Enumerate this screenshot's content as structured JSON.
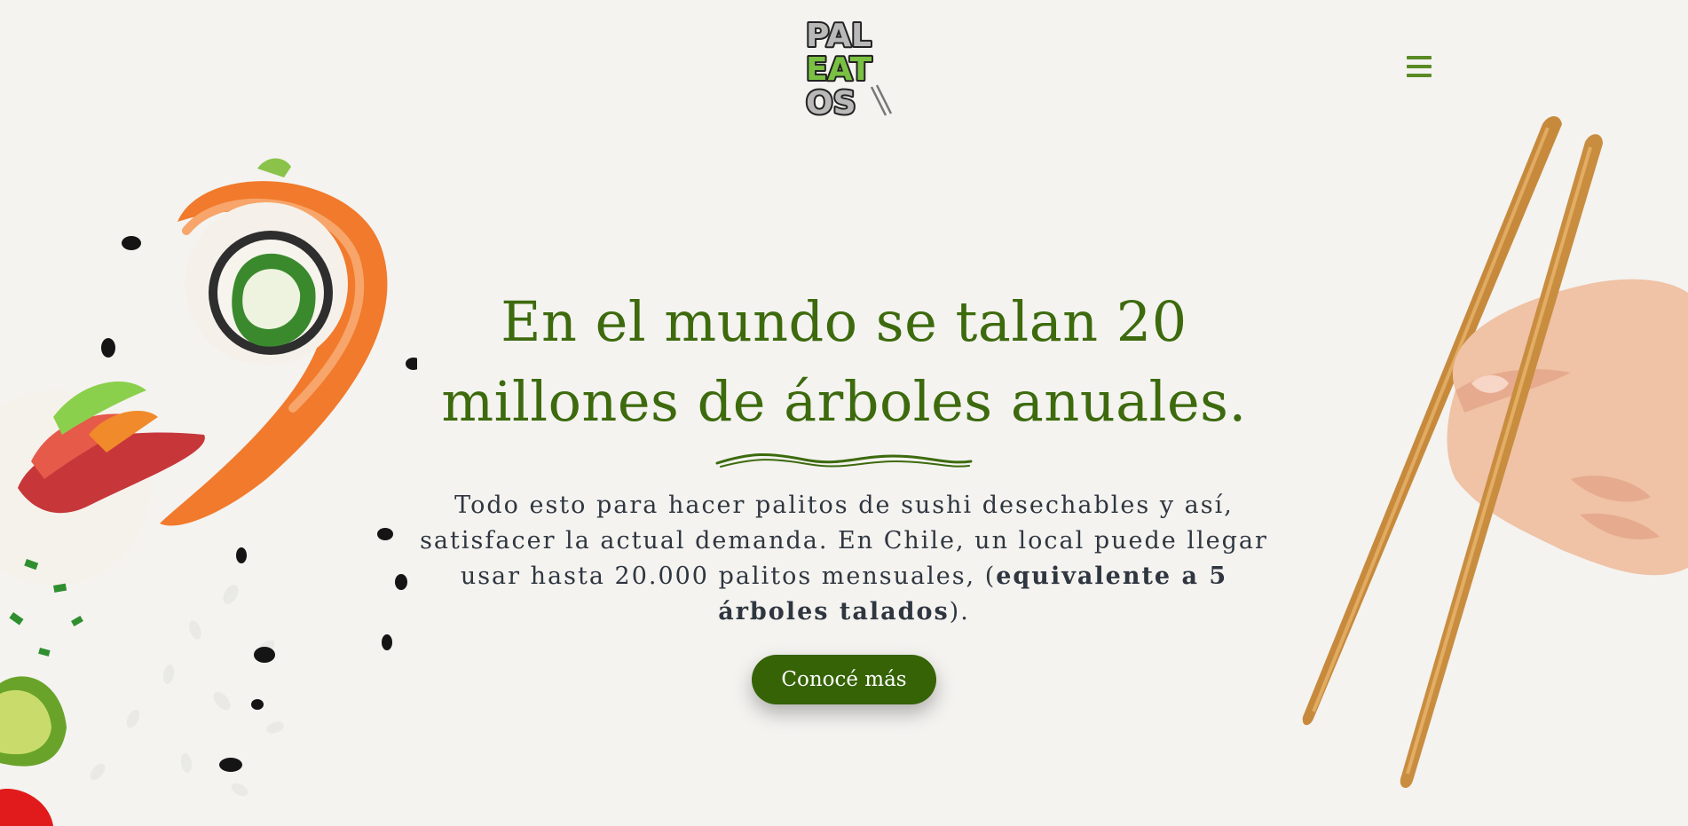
{
  "header": {
    "logo_text": [
      "PAL",
      "EAT",
      "OS"
    ],
    "menu_icon": "hamburger-menu-icon"
  },
  "hero": {
    "title_line1": "En el mundo se talan 20",
    "title_line2": "millones de árboles anuales.",
    "description_part1": "Todo esto para hacer palitos de sushi desechables y así, satisfacer la actual demanda. En Chile, un local puede llegar usar hasta 20.000 palitos mensuales, (",
    "description_bold": "equivalente a 5 árboles talados",
    "description_part2": ").",
    "cta_label": "Conocé más",
    "divider_icon": "wave-divider-icon"
  },
  "decor": {
    "left_image": "sushi-rolls-illustration",
    "right_image": "hand-with-chopsticks-illustration"
  },
  "colors": {
    "background": "#f4f3f0",
    "brand_green": "#3d6a0d",
    "logo_green": "#7ac143",
    "button_green": "#356306",
    "body_text": "#2f3640"
  }
}
